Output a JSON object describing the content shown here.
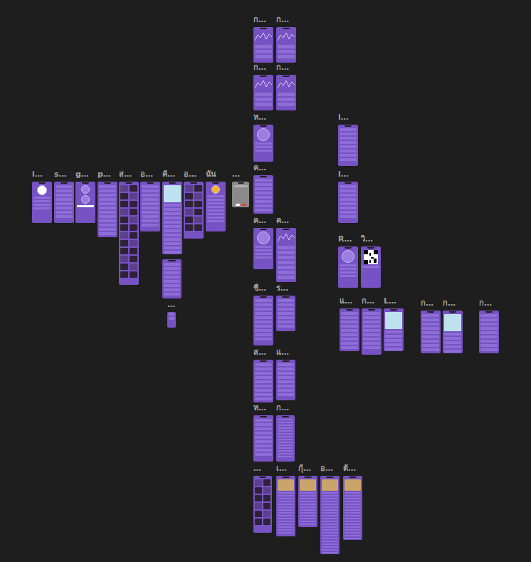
{
  "canvas": {
    "frames": [
      {
        "label": "i…",
        "kind": "login"
      },
      {
        "label": "s…",
        "kind": "form"
      },
      {
        "label": "g…",
        "kind": "gender"
      },
      {
        "label": "p…",
        "kind": "form"
      },
      {
        "label": "ส…",
        "kind": "photos"
      },
      {
        "label": "อ…",
        "kind": "list"
      },
      {
        "label": "ค้…",
        "kind": "map"
      },
      {
        "kind": "screen"
      },
      {
        "label": "…",
        "kind": "screen"
      },
      {
        "label": "อ…",
        "kind": "photos"
      },
      {
        "label": "ฉัน",
        "kind": "profile"
      },
      {
        "label": "…",
        "kind": "dialog"
      },
      {
        "label": "ก…",
        "kind": "chart"
      },
      {
        "label": "ก…",
        "kind": "chart"
      },
      {
        "label": "ก…",
        "kind": "chart"
      },
      {
        "label": "ก…",
        "kind": "chart"
      },
      {
        "label": "ห…",
        "kind": "gauge"
      },
      {
        "label": "ค…",
        "kind": "list"
      },
      {
        "label": "ค…",
        "kind": "gauge"
      },
      {
        "label": "ค…",
        "kind": "chart"
      },
      {
        "label": "ชื…",
        "kind": "list"
      },
      {
        "label": "ร…",
        "kind": "screen"
      },
      {
        "label": "ส…",
        "kind": "list"
      },
      {
        "label": "แ…",
        "kind": "screen"
      },
      {
        "label": "ห…",
        "kind": "list"
      },
      {
        "label": "ก…",
        "kind": "text"
      },
      {
        "label": "…",
        "kind": "photos"
      },
      {
        "label": "เ…",
        "kind": "food"
      },
      {
        "label": "กุ้…",
        "kind": "food"
      },
      {
        "label": "อ…",
        "kind": "food"
      },
      {
        "label": "ต้…",
        "kind": "food"
      },
      {
        "label": "i…",
        "kind": "form"
      },
      {
        "label": "i…",
        "kind": "form"
      },
      {
        "label": "R…",
        "kind": "gauge"
      },
      {
        "label": "วิ…",
        "kind": "qr"
      },
      {
        "label": "แ…",
        "kind": "list"
      },
      {
        "label": "ก…",
        "kind": "list"
      },
      {
        "label": "L…",
        "kind": "map"
      },
      {
        "label": "ก…",
        "kind": "list"
      },
      {
        "label": "ก…",
        "kind": "map"
      },
      {
        "label": "ก…",
        "kind": "list"
      }
    ]
  }
}
